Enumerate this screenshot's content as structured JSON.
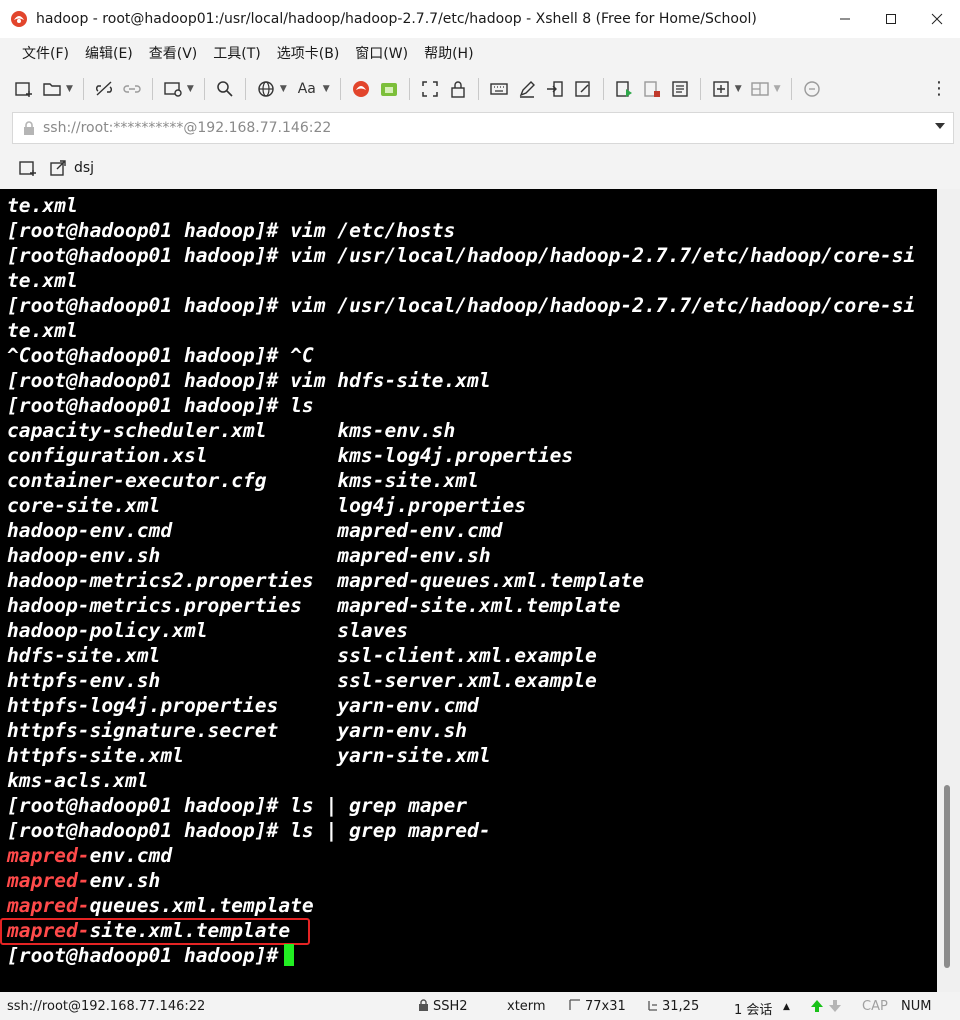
{
  "window": {
    "title": "hadoop - root@hadoop01:/usr/local/hadoop/hadoop-2.7.7/etc/hadoop - Xshell 8 (Free for Home/School)"
  },
  "menu": [
    "文件(F)",
    "编辑(E)",
    "查看(V)",
    "工具(T)",
    "选项卡(B)",
    "窗口(W)",
    "帮助(H)"
  ],
  "address": {
    "value": "ssh://root:**********@192.168.77.146:22"
  },
  "session": {
    "label": "dsj"
  },
  "terminal": {
    "lines": [
      "te.xml",
      "[root@hadoop01 hadoop]# vim /etc/hosts",
      "[root@hadoop01 hadoop]# vim /usr/local/hadoop/hadoop-2.7.7/etc/hadoop/core-si",
      "te.xml",
      "[root@hadoop01 hadoop]# vim /usr/local/hadoop/hadoop-2.7.7/etc/hadoop/core-si",
      "te.xml",
      "^Coot@hadoop01 hadoop]# ^C",
      "[root@hadoop01 hadoop]# vim hdfs-site.xml",
      "[root@hadoop01 hadoop]# ls",
      "capacity-scheduler.xml      kms-env.sh",
      "configuration.xsl           kms-log4j.properties",
      "container-executor.cfg      kms-site.xml",
      "core-site.xml               log4j.properties",
      "hadoop-env.cmd              mapred-env.cmd",
      "hadoop-env.sh               mapred-env.sh",
      "hadoop-metrics2.properties  mapred-queues.xml.template",
      "hadoop-metrics.properties   mapred-site.xml.template",
      "hadoop-policy.xml           slaves",
      "hdfs-site.xml               ssl-client.xml.example",
      "httpfs-env.sh               ssl-server.xml.example",
      "httpfs-log4j.properties     yarn-env.cmd",
      "httpfs-signature.secret     yarn-env.sh",
      "httpfs-site.xml             yarn-site.xml",
      "kms-acls.xml",
      "[root@hadoop01 hadoop]# ls | grep maper",
      "[root@hadoop01 hadoop]# ls | grep mapred-"
    ],
    "grep_matches": [
      {
        "match": "mapred-",
        "rest": "env.cmd"
      },
      {
        "match": "mapred-",
        "rest": "env.sh"
      },
      {
        "match": "mapred-",
        "rest": "queues.xml.template"
      },
      {
        "match": "mapred-",
        "rest": "site.xml.template"
      }
    ],
    "prompt": "[root@hadoop01 hadoop]#"
  },
  "status": {
    "connection": "ssh://root@192.168.77.146:22",
    "protocol": "SSH2",
    "term": "xterm",
    "size": "77x31",
    "cursor_pos": "31,25",
    "sessions": "1 会话",
    "caps": "CAP",
    "num": "NUM"
  },
  "colors": {
    "terminal_bg": "#000000",
    "terminal_fg": "#ffffff",
    "match_red": "#ff4a4a",
    "cursor_green": "#22ee22",
    "annotation_box": "#e52424"
  }
}
